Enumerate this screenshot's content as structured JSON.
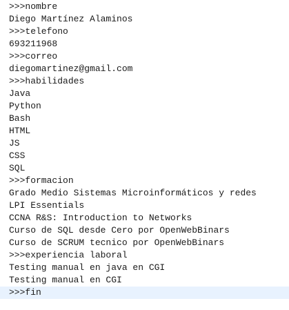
{
  "editor": {
    "lines": [
      ">>>nombre",
      "Diego Martínez Alaminos",
      ">>>telefono",
      "693211968",
      ">>>correo",
      "diegomartinez@gmail.com",
      ">>>habilidades",
      "Java",
      "Python",
      "Bash",
      "HTML",
      "JS",
      "CSS",
      "SQL",
      ">>>formacion",
      "Grado Medio Sistemas Microinformáticos y redes",
      "LPI Essentials",
      "CCNA R&S: Introduction to Networks",
      "Curso de SQL desde Cero por OpenWebBinars",
      "Curso de SCRUM tecnico por OpenWebBinars",
      ">>>experiencia laboral",
      "Testing manual en java en CGI",
      "Testing manual en CGI",
      ">>>fin"
    ],
    "active_line_index": 23,
    "colors": {
      "background": "#ffffff",
      "text": "#1a1a1a",
      "active_line": "#e8f2fe"
    }
  }
}
